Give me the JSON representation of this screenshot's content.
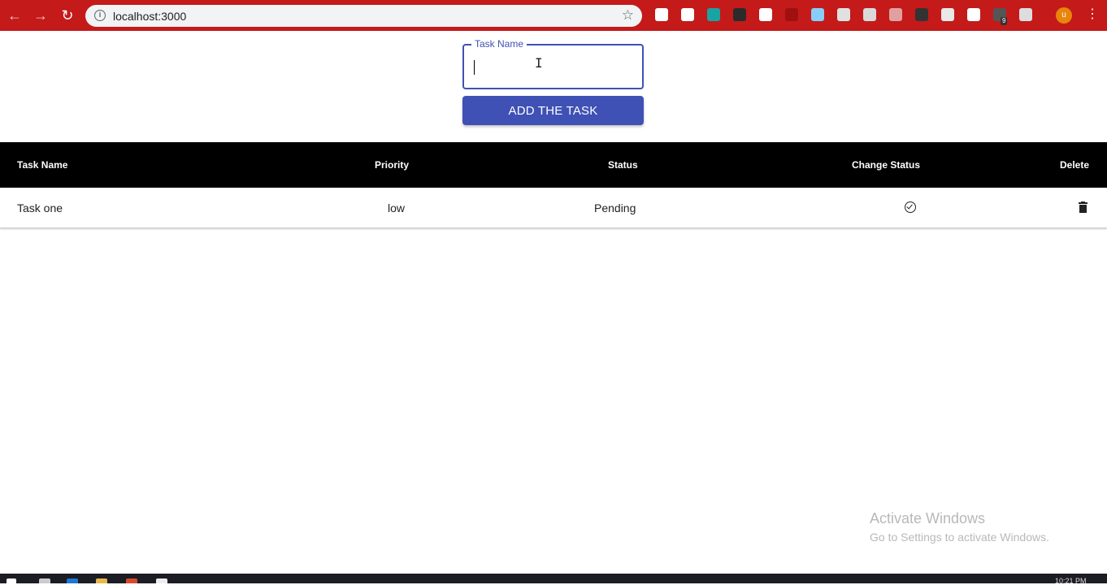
{
  "browser": {
    "url": "localhost:3000",
    "profile_initial": "u",
    "extension_badge": "9",
    "nav_icons": [
      "back-arrow-icon",
      "forward-arrow-icon",
      "reload-icon"
    ],
    "extension_icons": [
      {
        "name": "ext-icon-1",
        "color": "#ffffff"
      },
      {
        "name": "ext-icon-2",
        "color": "#ffffff"
      },
      {
        "name": "ext-icon-3",
        "color": "#1aa3a3"
      },
      {
        "name": "ext-icon-4",
        "color": "#2b2b2b"
      },
      {
        "name": "ext-icon-5",
        "color": "#ffffff"
      },
      {
        "name": "ext-icon-6",
        "color": "#a01010"
      },
      {
        "name": "ext-icon-7",
        "color": "#87cefa"
      },
      {
        "name": "ext-icon-8",
        "color": "#e0e0e0"
      },
      {
        "name": "ext-icon-9",
        "color": "#d9d9d9"
      },
      {
        "name": "ext-icon-10",
        "color": "#e0a0a0"
      },
      {
        "name": "ext-icon-11",
        "color": "#333333"
      },
      {
        "name": "ext-icon-12",
        "color": "#e8e8e8"
      },
      {
        "name": "ext-icon-13",
        "color": "#ffffff"
      },
      {
        "name": "ext-icon-14",
        "color": "#555555"
      },
      {
        "name": "ext-icon-15",
        "color": "#dddddd"
      }
    ],
    "bar_color": "#c41a1a"
  },
  "form": {
    "field_label": "Task Name",
    "field_value": "",
    "submit_label": "ADD THE TASK",
    "accent_color": "#3f51b5"
  },
  "table": {
    "columns": [
      "Task Name",
      "Priority",
      "Status",
      "Change Status",
      "Delete"
    ],
    "rows": [
      {
        "task_name": "Task one",
        "priority": "low",
        "status": "Pending",
        "change_status_icon": "check-circle-icon",
        "delete_icon": "trash-icon"
      }
    ]
  },
  "watermark": {
    "title": "Activate Windows",
    "subtitle": "Go to Settings to activate Windows."
  },
  "taskbar": {
    "clock": "10:21 PM"
  }
}
